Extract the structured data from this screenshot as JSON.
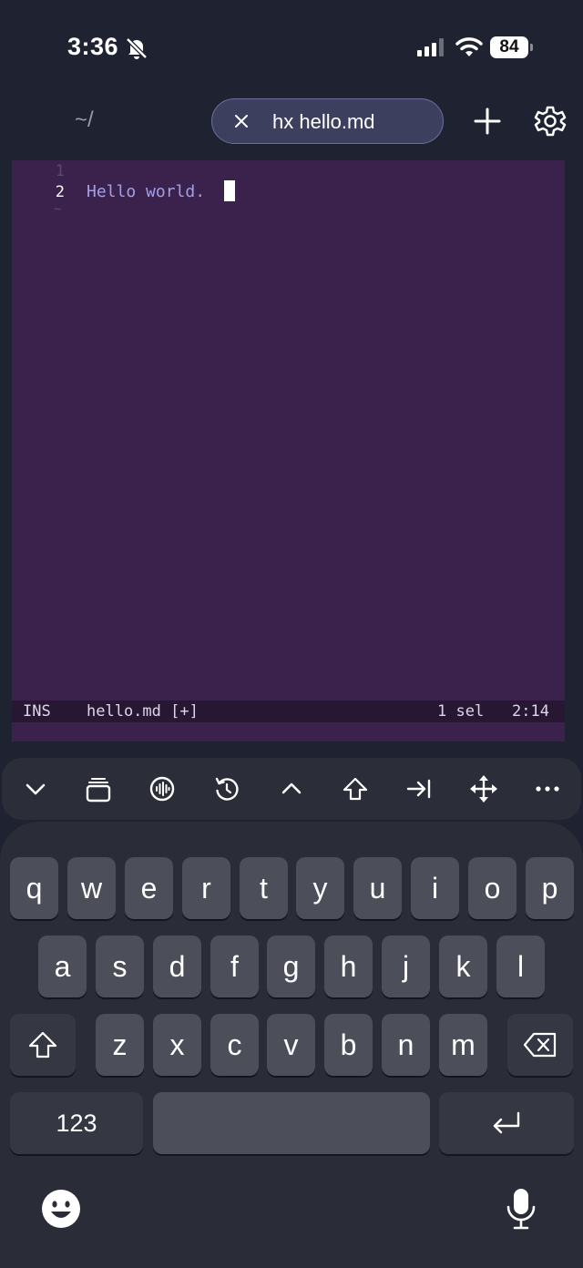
{
  "status_bar": {
    "time": "3:36",
    "battery_level": "84",
    "icons": [
      "bell-slash-icon",
      "cellular-signal-icon",
      "wifi-icon",
      "battery-icon"
    ]
  },
  "top_bar": {
    "cwd": "~/",
    "active_tab": {
      "label": "hx hello.md",
      "close_icon": "close-icon"
    },
    "add_icon": "plus-icon",
    "settings_icon": "gear-icon"
  },
  "editor": {
    "line_numbers": [
      "1",
      "2"
    ],
    "empty_marker": "~",
    "lines": [
      "",
      "Hello world."
    ],
    "statusline": {
      "mode": "INS",
      "file": "hello.md [+]",
      "selections": "1 sel",
      "position": "2:14"
    }
  },
  "accessory_bar": {
    "buttons": [
      "chevron-down-icon",
      "tabs-stack-icon",
      "voice-waveform-icon",
      "history-icon",
      "control-caret-icon",
      "shift-arrow-icon",
      "tab-arrow-icon",
      "move-arrows-icon",
      "more-icon"
    ]
  },
  "keyboard": {
    "row1": [
      "q",
      "w",
      "e",
      "r",
      "t",
      "y",
      "u",
      "i",
      "o",
      "p"
    ],
    "row2": [
      "a",
      "s",
      "d",
      "f",
      "g",
      "h",
      "j",
      "k",
      "l"
    ],
    "row3": [
      "z",
      "x",
      "c",
      "v",
      "b",
      "n",
      "m"
    ],
    "numbers_label": "123",
    "icons": [
      "shift-icon",
      "backspace-icon",
      "return-icon",
      "emoji-icon",
      "microphone-icon"
    ]
  },
  "colors": {
    "editor_bg": "#3b224c",
    "statusline_bg": "#281733",
    "code_text": "#a4a0e8",
    "key_bg": "#4c4e5a",
    "background": "#1f2231"
  }
}
